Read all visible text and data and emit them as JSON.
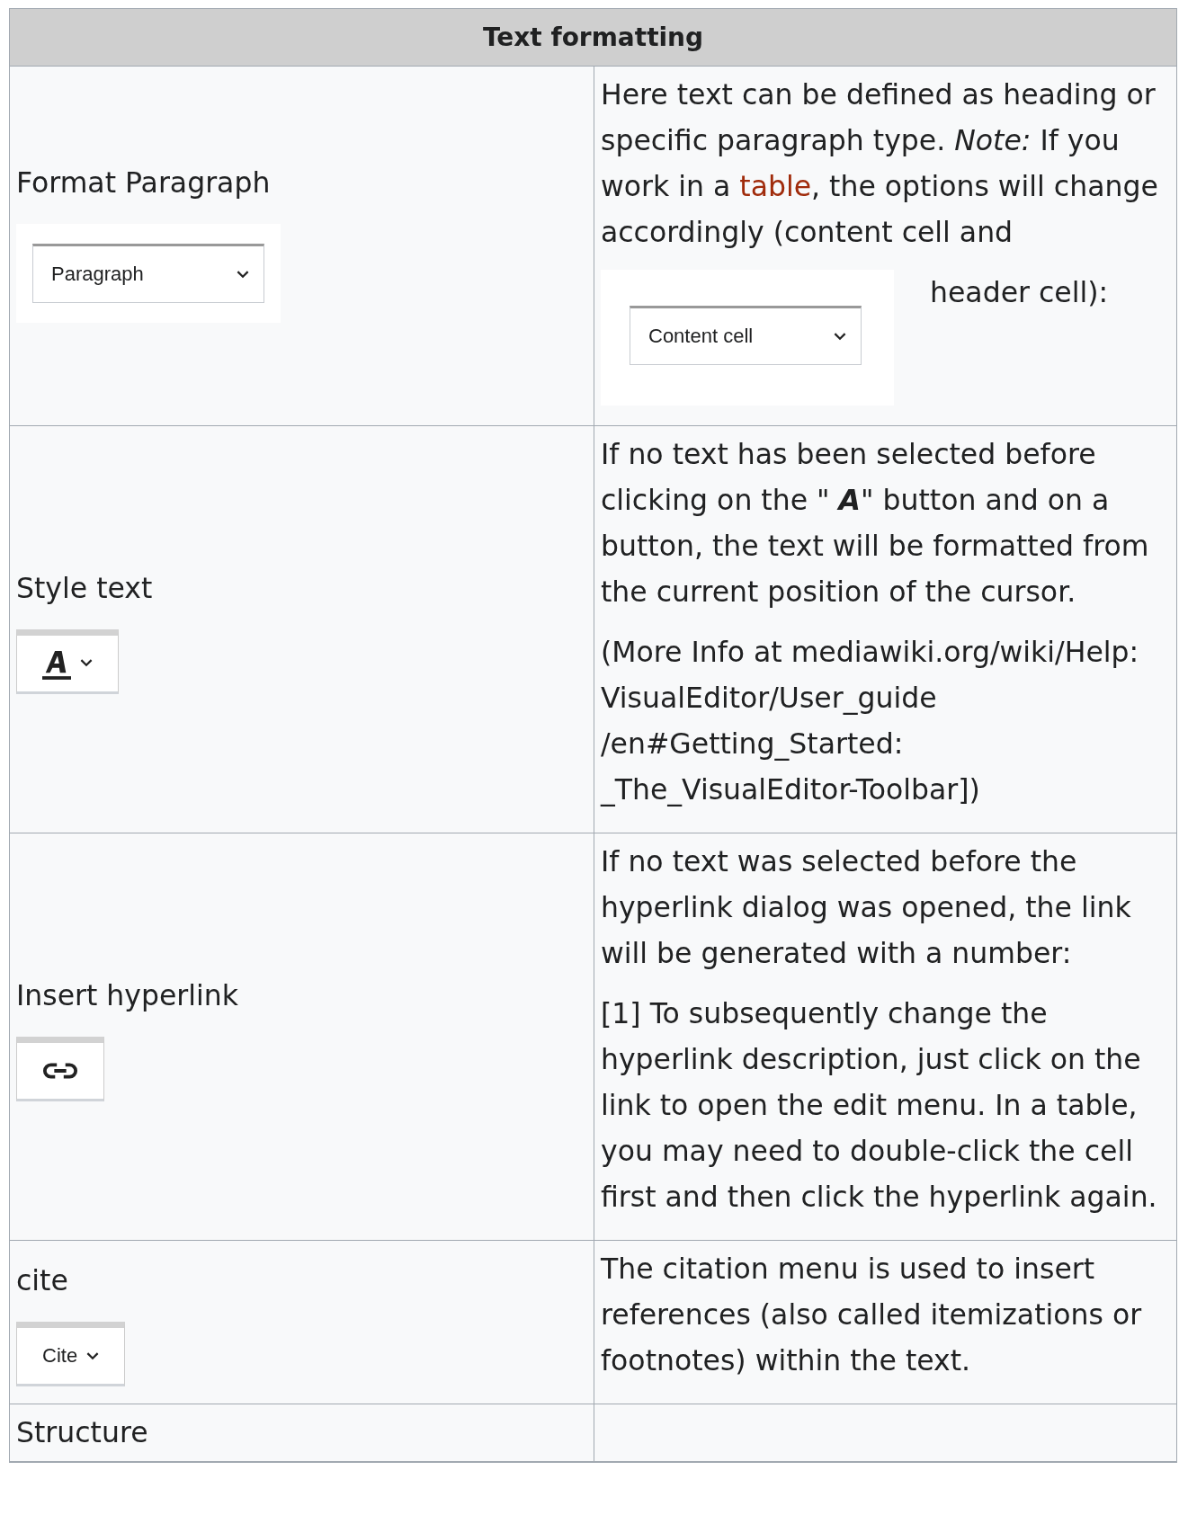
{
  "table": {
    "title": "Text formatting",
    "rows": [
      {
        "label": "Format Paragraph",
        "widget": {
          "kind": "select",
          "text": "Paragraph"
        },
        "blocks": [
          {
            "kind": "text",
            "segments": [
              {
                "text": "Here text can be defined as heading or specific paragraph type. *Note:* If you work in a "
              },
              {
                "text": "table",
                "link": true
              },
              {
                "text": ", the options will change accordingly (content cell and"
              }
            ]
          },
          {
            "kind": "select",
            "text": "Content cell"
          },
          {
            "kind": "text",
            "segments": [
              {
                "text": "header cell):"
              }
            ]
          }
        ]
      },
      {
        "label": "Style text",
        "widget": {
          "kind": "textstyle"
        },
        "blocks": [
          {
            "kind": "text",
            "segments": [
              {
                "text": "If no text has been selected before clicking on the \" **A**\" button and on a button, the text will be formatted from the current position of the cursor."
              }
            ]
          },
          {
            "kind": "text",
            "segments": [
              {
                "text": "(More Info at mediawiki.org/wiki/Help:\nVisualEditor/User_guide\n/en#Getting_Started:\n_The_VisualEditor-Toolbar])"
              }
            ]
          }
        ]
      },
      {
        "label": "Insert hyperlink",
        "widget": {
          "kind": "link"
        },
        "blocks": [
          {
            "kind": "text",
            "segments": [
              {
                "text": "If no text was selected before the hyperlink dialog was opened, the link will be generated with a number:"
              }
            ]
          },
          {
            "kind": "text",
            "segments": [
              {
                "text": "[1] To subsequently change the hyperlink description, just click on the link to open the edit menu. In a table, you may need to double-click the cell first and then click the hyperlink again."
              }
            ]
          }
        ]
      },
      {
        "label": "cite",
        "widget": {
          "kind": "menu",
          "text": "Cite"
        },
        "blocks": [
          {
            "kind": "text",
            "segments": [
              {
                "text": "The citation menu is used to insert references (also called itemizations or footnotes) within the text."
              }
            ]
          }
        ]
      },
      {
        "label": "Structure",
        "blocks": []
      }
    ]
  }
}
